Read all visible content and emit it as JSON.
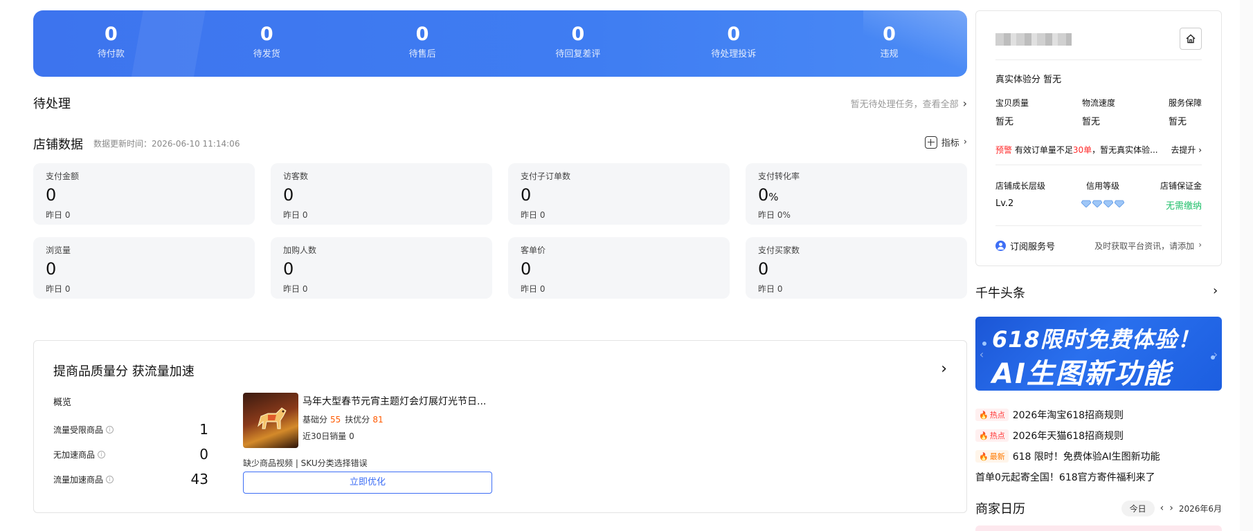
{
  "banner": {
    "stats": [
      {
        "value": "0",
        "label": "待付款"
      },
      {
        "value": "0",
        "label": "待发货"
      },
      {
        "value": "0",
        "label": "待售后"
      },
      {
        "value": "0",
        "label": "待回复差评"
      },
      {
        "value": "0",
        "label": "待处理投诉"
      },
      {
        "value": "0",
        "label": "违规"
      }
    ]
  },
  "todo": {
    "title": "待处理",
    "link": "暂无待处理任务，查看全部"
  },
  "shop": {
    "title": "店铺数据",
    "update_time": "数据更新时间：2026-06-10 11:14:06",
    "indicator_label": "指标",
    "metrics": [
      {
        "label": "支付金额",
        "value": "0",
        "unit": "",
        "yesterday": "昨日 0"
      },
      {
        "label": "访客数",
        "value": "0",
        "unit": "",
        "yesterday": "昨日 0"
      },
      {
        "label": "支付子订单数",
        "value": "0",
        "unit": "",
        "yesterday": "昨日 0"
      },
      {
        "label": "支付转化率",
        "value": "0",
        "unit": "%",
        "yesterday": "昨日 0%"
      },
      {
        "label": "浏览量",
        "value": "0",
        "unit": "",
        "yesterday": "昨日 0"
      },
      {
        "label": "加购人数",
        "value": "0",
        "unit": "",
        "yesterday": "昨日 0"
      },
      {
        "label": "客单价",
        "value": "0",
        "unit": "",
        "yesterday": "昨日 0"
      },
      {
        "label": "支付买家数",
        "value": "0",
        "unit": "",
        "yesterday": "昨日 0"
      }
    ]
  },
  "quality": {
    "title": "提商品质量分 获流量加速",
    "overview": "概览",
    "rows": [
      {
        "label": "流量受限商品",
        "value": "1"
      },
      {
        "label": "无加速商品",
        "value": "0"
      },
      {
        "label": "流量加速商品",
        "value": "43"
      }
    ],
    "product": {
      "name": "马年大型春节元宵主题灯会灯展灯光节日...",
      "base_label": "基础分",
      "base_score": "55",
      "support_label": "扶优分",
      "support_score": "81",
      "sales": "近30日销量 0",
      "issues": "缺少商品视频 | SKU分类选择错误",
      "button": "立即优化"
    }
  },
  "side": {
    "experience": "真实体验分  暂无",
    "scores": [
      {
        "label": "宝贝质量",
        "value": "暂无"
      },
      {
        "label": "物流速度",
        "value": "暂无"
      },
      {
        "label": "服务保障",
        "value": "暂无"
      }
    ],
    "warn_tag": "预警",
    "warn_text1": "有效订单量不足",
    "warn_red": "30单",
    "warn_text2": "，暂无真实体验...",
    "warn_action": "去提升",
    "levels": [
      {
        "label": "店铺成长层级",
        "value": "Lv.2"
      },
      {
        "label": "信用等级",
        "value": ""
      },
      {
        "label": "店铺保证金",
        "value": "无需缴纳"
      }
    ],
    "diamond_count": 4,
    "subscribe_label": "订阅服务号",
    "subscribe_hint": "及时获取平台资讯，请添加"
  },
  "news": {
    "title": "千牛头条",
    "banner_line1": "618限时免费体验！",
    "banner_line2": "AI生图新功能",
    "items": [
      {
        "tag": "热点",
        "tag_type": "hot",
        "text": "2026年淘宝618招商规则"
      },
      {
        "tag": "热点",
        "tag_type": "hot",
        "text": "2026年天猫618招商规则"
      },
      {
        "tag": "最新",
        "tag_type": "new",
        "text": "618 限时！免费体验AI生图新功能"
      },
      {
        "tag": "",
        "tag_type": "",
        "text": "首单0元起寄全国！618官方寄件福利来了"
      }
    ]
  },
  "calendar": {
    "title": "商家日历",
    "today": "今日",
    "month": "2026年6月"
  },
  "colors": {
    "banner_blue": "#3d74ee",
    "accent_blue": "#3d6ef5",
    "orange": "#ff5a00",
    "red": "#ff2a2a",
    "green": "#1fbf6a"
  }
}
